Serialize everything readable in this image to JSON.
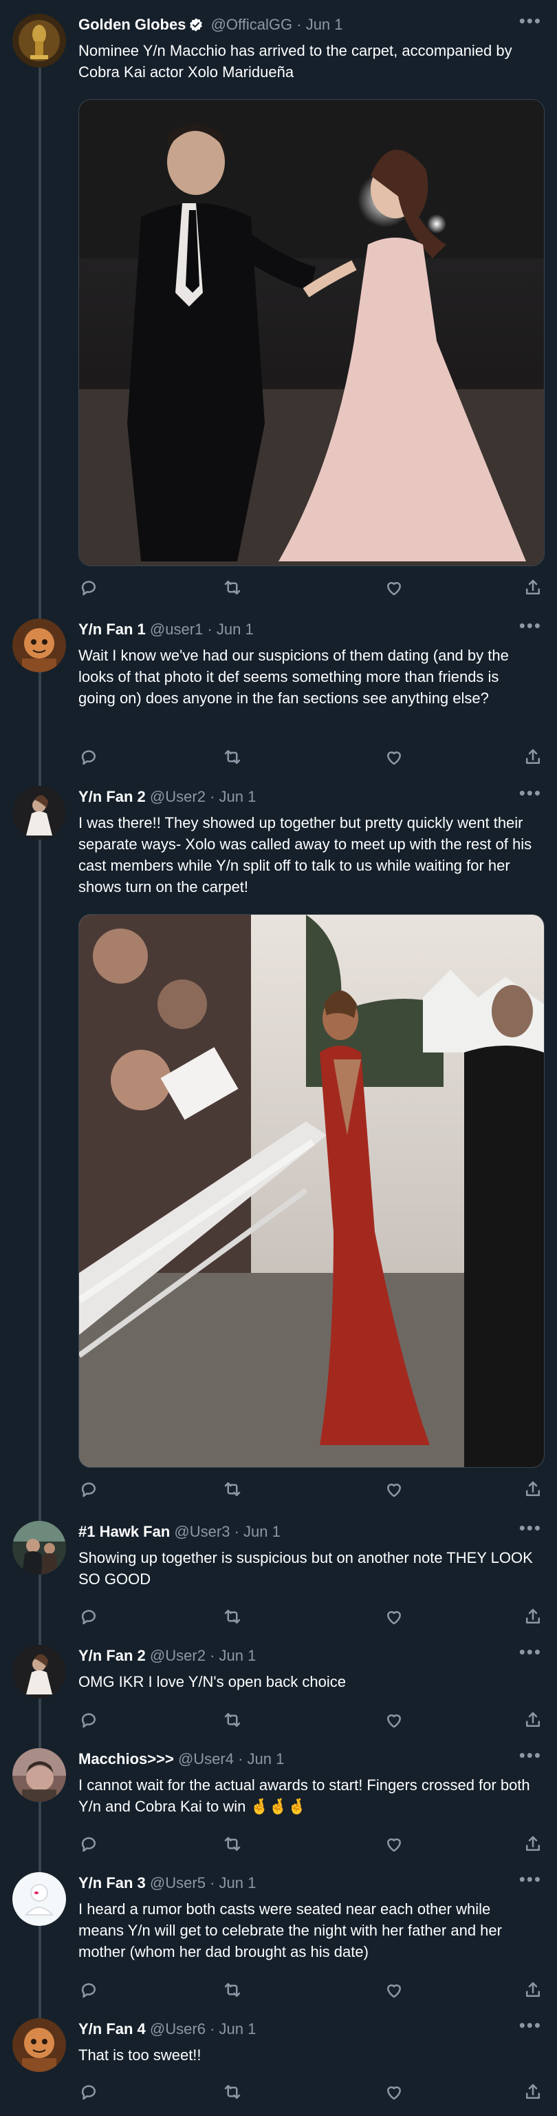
{
  "colors": {
    "background": "#15202b",
    "text": "#ffffff",
    "muted": "#8b98a5",
    "border": "#38444d",
    "verified": "#ffffff"
  },
  "icons": {
    "reply": "reply-icon",
    "retweet": "retweet-icon",
    "like": "like-icon",
    "share": "share-icon",
    "more": "more-icon",
    "verified": "verified-badge-icon"
  },
  "tweets": [
    {
      "name": "Golden Globes",
      "handle": "@OfficalGG",
      "dot": "·",
      "date": "Jun 1",
      "text": "Nominee Y/n Macchio has arrived to the carpet, accompanied by Cobra Kai actor Xolo Maridueña",
      "more": "•••"
    },
    {
      "name": "Y/n Fan 1",
      "handle": "@user1",
      "dot": "·",
      "date": "Jun 1",
      "text": "Wait I know we've had our suspicions of them dating (and by the looks of that photo it def seems something more than friends is going on) does anyone in the fan sections see anything else?",
      "more": "•••"
    },
    {
      "name": "Y/n Fan 2",
      "handle": "@User2",
      "dot": "·",
      "date": "Jun 1",
      "text": "I was there!! They showed up together but pretty quickly went their separate ways- Xolo was called away to meet up with the rest of his cast members while Y/n split off to talk to us while waiting for her shows turn on the carpet!",
      "more": "•••"
    },
    {
      "name": "#1 Hawk Fan",
      "handle": "@User3",
      "dot": "·",
      "date": "Jun 1",
      "text": "Showing up together is suspicious but on another note THEY LOOK SO GOOD",
      "more": "•••"
    },
    {
      "name": "Y/n Fan 2",
      "handle": "@User2",
      "dot": "·",
      "date": "Jun 1",
      "text": "OMG IKR I love Y/N's open back choice",
      "more": "•••"
    },
    {
      "name": "Macchios>>>",
      "handle": "@User4",
      "dot": "·",
      "date": "Jun 1",
      "text": "I cannot wait for the actual awards to start! Fingers crossed for both Y/n and Cobra Kai to win 🤞🤞🤞",
      "more": "•••"
    },
    {
      "name": "Y/n Fan 3",
      "handle": "@User5",
      "dot": "·",
      "date": "Jun 1",
      "text": "I heard a rumor both casts were seated near each other while means Y/n will get to celebrate the night with her father and her mother (whom her dad brought as his date)",
      "more": "•••"
    },
    {
      "name": "Y/n Fan 4",
      "handle": "@User6",
      "dot": "·",
      "date": "Jun 1",
      "text": "That is too sweet!!",
      "more": "•••"
    }
  ]
}
